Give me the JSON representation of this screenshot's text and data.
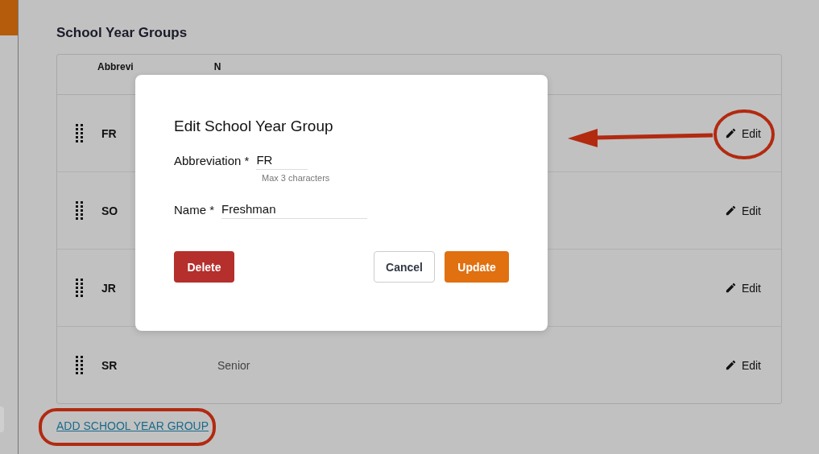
{
  "section": {
    "title": "School Year Groups"
  },
  "table": {
    "columns": [
      "Abbrevi",
      "N"
    ],
    "rows": [
      {
        "abbreviation": "FR",
        "edit": "Edit"
      },
      {
        "abbreviation": "SO",
        "edit": "Edit"
      },
      {
        "abbreviation": "JR",
        "edit": "Edit"
      },
      {
        "abbreviation": "SR",
        "name": "Senior",
        "edit": "Edit"
      }
    ]
  },
  "add_link": "ADD SCHOOL YEAR GROUP",
  "dialog": {
    "title": "Edit School Year Group",
    "fields": [
      {
        "label": "Abbreviation *",
        "value": "FR",
        "hint": "Max 3 characters",
        "kind": "short"
      },
      {
        "label": "Name *",
        "value": "Freshman",
        "kind": "long"
      }
    ],
    "buttons": [
      {
        "label": "Delete",
        "kind": "danger"
      },
      {
        "label": "Cancel",
        "kind": "secondary"
      },
      {
        "label": "Update",
        "kind": "primary"
      }
    ]
  }
}
